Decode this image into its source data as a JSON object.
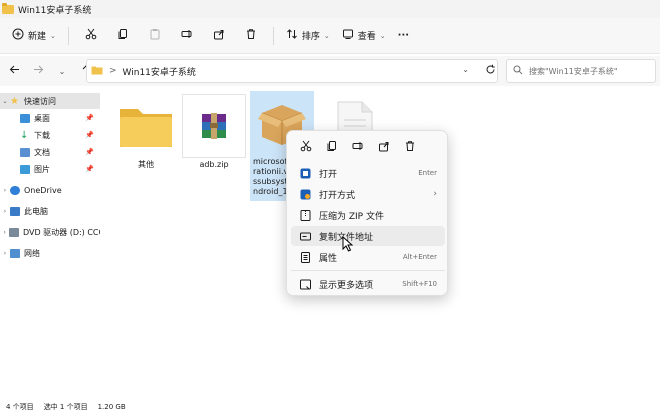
{
  "window": {
    "title": "Win11安卓子系统"
  },
  "toolbar": {
    "new_label": "新建",
    "sort_label": "排序",
    "view_label": "查看",
    "more_label": "···"
  },
  "address": {
    "path": [
      "Win11安卓子系统"
    ],
    "separator": ">"
  },
  "search": {
    "placeholder": "搜索\"Win11安卓子系统\""
  },
  "sidebar": {
    "items": [
      {
        "label": "快速访问",
        "icon": "star-icon"
      },
      {
        "label": "桌面",
        "icon": "desktop-icon"
      },
      {
        "label": "下载",
        "icon": "download-icon"
      },
      {
        "label": "文档",
        "icon": "document-icon"
      },
      {
        "label": "图片",
        "icon": "picture-icon"
      },
      {
        "label": "OneDrive",
        "icon": "cloud-icon"
      },
      {
        "label": "此电脑",
        "icon": "computer-icon"
      },
      {
        "label": "DVD 驱动器 (D:) CCC",
        "icon": "dvd-icon"
      },
      {
        "label": "网络",
        "icon": "network-icon"
      }
    ]
  },
  "files": [
    {
      "name": "其他",
      "type": "folder"
    },
    {
      "name": "adb.zip",
      "type": "zip"
    },
    {
      "name_lines": [
        "microsof",
        "rationii.v",
        "ssubsyste",
        "ndroid_1"
      ],
      "type": "package"
    },
    {
      "name": "",
      "type": "document"
    }
  ],
  "context_menu": {
    "top_icons": [
      "cut-icon",
      "copy-icon",
      "rename-icon",
      "share-icon",
      "delete-icon"
    ],
    "items": [
      {
        "label": "打开",
        "shortcut": "Enter"
      },
      {
        "label": "打开方式",
        "shortcut": ""
      },
      {
        "label": "压缩为 ZIP 文件",
        "shortcut": ""
      },
      {
        "label": "复制文件地址",
        "shortcut": ""
      },
      {
        "label": "属性",
        "shortcut": "Alt+Enter"
      },
      {
        "label": "显示更多选项",
        "shortcut": "Shift+F10"
      }
    ]
  },
  "status": {
    "count": "4 个项目",
    "selection": "选中 1 个项目",
    "size": "1.20 GB"
  },
  "colors": {
    "folder": "#f1c24b",
    "accent": "#0067c0",
    "selection": "#cce4f7"
  }
}
